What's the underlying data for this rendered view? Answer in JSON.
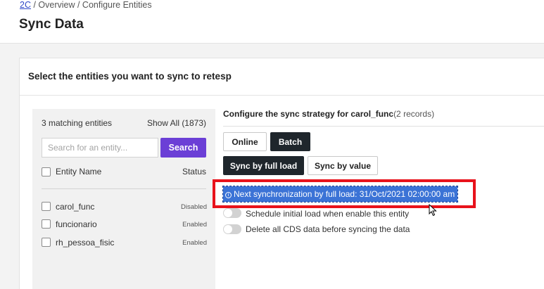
{
  "breadcrumb": {
    "link": "2C",
    "rest": " / Overview / Configure Entities"
  },
  "page": {
    "title": "Sync Data"
  },
  "card": {
    "title": "Select the entities you want to sync to retesp"
  },
  "entities_panel": {
    "count_label": "3 matching entities",
    "show_all_label": "Show All (1873)",
    "search": {
      "placeholder": "Search for an entity...",
      "value": ""
    },
    "search_button": "Search",
    "columns": {
      "name": "Entity Name",
      "status": "Status"
    },
    "rows": [
      {
        "name": "carol_func",
        "status": "Disabled"
      },
      {
        "name": "funcionario",
        "status": "Enabled"
      },
      {
        "name": "rh_pessoa_fisic",
        "status": "Enabled"
      }
    ]
  },
  "strategy": {
    "title_prefix": "Configure the sync strategy for carol_func",
    "records": "(2 records)",
    "mode_buttons": {
      "online": "Online",
      "batch": "Batch"
    },
    "load_buttons": {
      "full": "Sync by full load",
      "value": "Sync by value"
    },
    "next_sync_text": "Next synchronization by full load: 31/Oct/2021 02:00:00 am",
    "info_icon": "i",
    "toggles": [
      {
        "label": "Schedule initial load when enable this entity",
        "on": false
      },
      {
        "label": "Delete all CDS data before syncing the data",
        "on": false
      }
    ]
  },
  "colors": {
    "accent_purple": "#6b3fd6",
    "dark_button": "#1f262c",
    "selection_blue": "#3b73d6",
    "annotation_red": "#e8121b"
  }
}
